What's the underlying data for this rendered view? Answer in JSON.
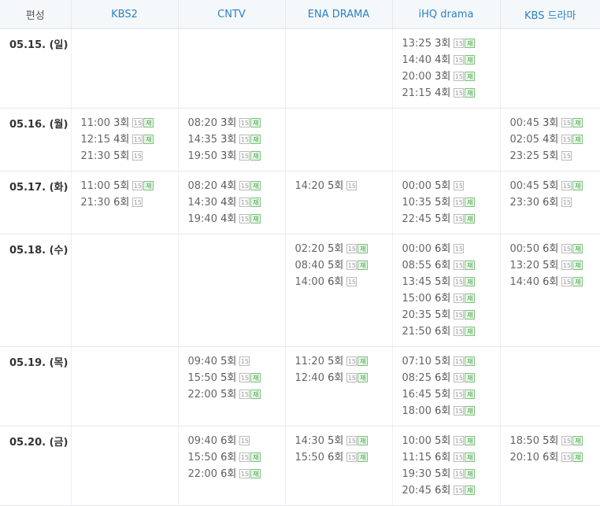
{
  "header": {
    "corner_label": "편성",
    "channels": [
      "KBS2",
      "CNTV",
      "ENA DRAMA",
      "iHQ drama",
      "KBS 드라마"
    ]
  },
  "badges": {
    "age": "15",
    "rerun": "재"
  },
  "rows": [
    {
      "date": "05.15. (일)",
      "cells": [
        [],
        [],
        [],
        [
          {
            "time": "13:25",
            "ep": "3회",
            "rerun": true
          },
          {
            "time": "14:40",
            "ep": "4회",
            "rerun": true
          },
          {
            "time": "20:00",
            "ep": "3회",
            "rerun": true
          },
          {
            "time": "21:15",
            "ep": "4회",
            "rerun": true
          }
        ],
        []
      ]
    },
    {
      "date": "05.16. (월)",
      "cells": [
        [
          {
            "time": "11:00",
            "ep": "3회",
            "rerun": true
          },
          {
            "time": "12:15",
            "ep": "4회",
            "rerun": true
          },
          {
            "time": "21:30",
            "ep": "5회",
            "rerun": false
          }
        ],
        [
          {
            "time": "08:20",
            "ep": "3회",
            "rerun": true
          },
          {
            "time": "14:35",
            "ep": "3회",
            "rerun": true
          },
          {
            "time": "19:50",
            "ep": "3회",
            "rerun": true
          }
        ],
        [],
        [],
        [
          {
            "time": "00:45",
            "ep": "3회",
            "rerun": true
          },
          {
            "time": "02:05",
            "ep": "4회",
            "rerun": true
          },
          {
            "time": "23:25",
            "ep": "5회",
            "rerun": false
          }
        ]
      ]
    },
    {
      "date": "05.17. (화)",
      "cells": [
        [
          {
            "time": "11:00",
            "ep": "5회",
            "rerun": true
          },
          {
            "time": "21:30",
            "ep": "6회",
            "rerun": false
          }
        ],
        [
          {
            "time": "08:20",
            "ep": "4회",
            "rerun": true
          },
          {
            "time": "14:30",
            "ep": "4회",
            "rerun": true
          },
          {
            "time": "19:40",
            "ep": "4회",
            "rerun": true
          }
        ],
        [
          {
            "time": "14:20",
            "ep": "5회",
            "rerun": false
          }
        ],
        [
          {
            "time": "00:00",
            "ep": "5회",
            "rerun": false
          },
          {
            "time": "10:35",
            "ep": "5회",
            "rerun": true
          },
          {
            "time": "22:45",
            "ep": "5회",
            "rerun": true
          }
        ],
        [
          {
            "time": "00:45",
            "ep": "5회",
            "rerun": true
          },
          {
            "time": "23:30",
            "ep": "6회",
            "rerun": false
          }
        ]
      ]
    },
    {
      "date": "05.18. (수)",
      "cells": [
        [],
        [],
        [
          {
            "time": "02:20",
            "ep": "5회",
            "rerun": true
          },
          {
            "time": "08:40",
            "ep": "5회",
            "rerun": true
          },
          {
            "time": "14:00",
            "ep": "6회",
            "rerun": false
          }
        ],
        [
          {
            "time": "00:00",
            "ep": "6회",
            "rerun": false
          },
          {
            "time": "08:55",
            "ep": "6회",
            "rerun": true
          },
          {
            "time": "13:45",
            "ep": "5회",
            "rerun": true
          },
          {
            "time": "15:00",
            "ep": "6회",
            "rerun": true
          },
          {
            "time": "20:35",
            "ep": "5회",
            "rerun": true
          },
          {
            "time": "21:50",
            "ep": "6회",
            "rerun": true
          }
        ],
        [
          {
            "time": "00:50",
            "ep": "6회",
            "rerun": true
          },
          {
            "time": "13:20",
            "ep": "5회",
            "rerun": true
          },
          {
            "time": "14:40",
            "ep": "6회",
            "rerun": true
          }
        ]
      ]
    },
    {
      "date": "05.19. (목)",
      "cells": [
        [],
        [
          {
            "time": "09:40",
            "ep": "5회",
            "rerun": false
          },
          {
            "time": "15:50",
            "ep": "5회",
            "rerun": true
          },
          {
            "time": "22:00",
            "ep": "5회",
            "rerun": true
          }
        ],
        [
          {
            "time": "11:20",
            "ep": "5회",
            "rerun": true
          },
          {
            "time": "12:40",
            "ep": "6회",
            "rerun": true
          }
        ],
        [
          {
            "time": "07:10",
            "ep": "5회",
            "rerun": true
          },
          {
            "time": "08:25",
            "ep": "6회",
            "rerun": true
          },
          {
            "time": "16:45",
            "ep": "5회",
            "rerun": true
          },
          {
            "time": "18:00",
            "ep": "6회",
            "rerun": true
          }
        ],
        []
      ]
    },
    {
      "date": "05.20. (금)",
      "cells": [
        [],
        [
          {
            "time": "09:40",
            "ep": "6회",
            "rerun": false
          },
          {
            "time": "15:50",
            "ep": "6회",
            "rerun": true
          },
          {
            "time": "22:00",
            "ep": "6회",
            "rerun": true
          }
        ],
        [
          {
            "time": "14:30",
            "ep": "5회",
            "rerun": true
          },
          {
            "time": "15:50",
            "ep": "6회",
            "rerun": true
          }
        ],
        [
          {
            "time": "10:00",
            "ep": "5회",
            "rerun": true
          },
          {
            "time": "11:15",
            "ep": "6회",
            "rerun": true
          },
          {
            "time": "19:30",
            "ep": "5회",
            "rerun": true
          },
          {
            "time": "20:45",
            "ep": "6회",
            "rerun": true
          }
        ],
        [
          {
            "time": "18:50",
            "ep": "5회",
            "rerun": true
          },
          {
            "time": "20:10",
            "ep": "6회",
            "rerun": true
          }
        ]
      ]
    }
  ]
}
